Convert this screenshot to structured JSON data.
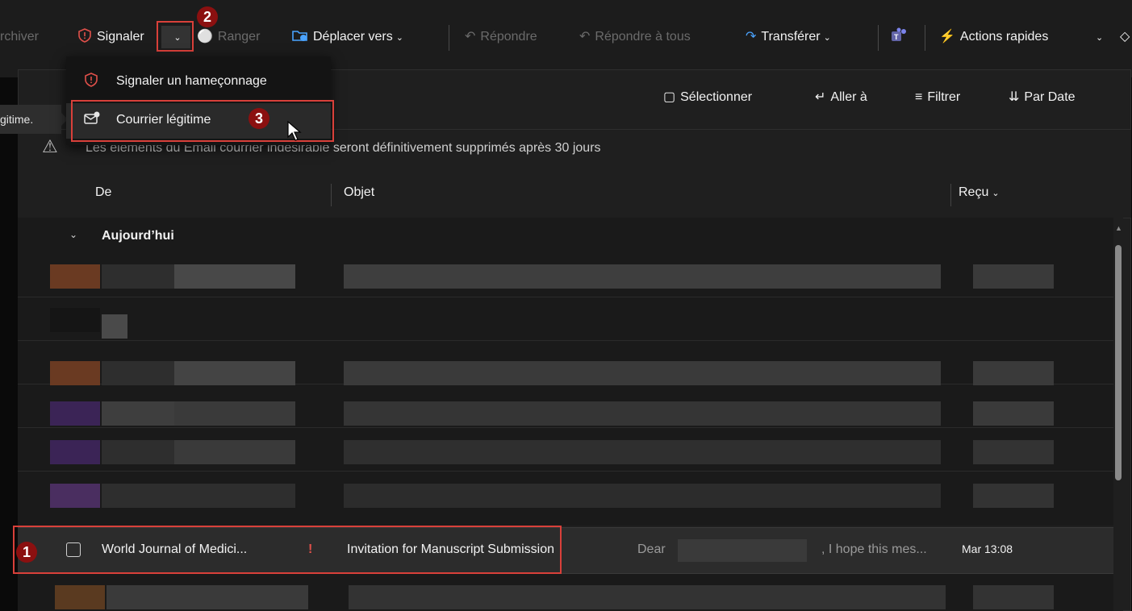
{
  "toolbar": {
    "archive_label": "rchiver",
    "report_label": "Signaler",
    "sweep_label": "Ranger",
    "move_label": "Déplacer vers",
    "reply_label": "Répondre",
    "reply_all_label": "Répondre à tous",
    "forward_label": "Transférer",
    "quick_actions_label": "Actions rapides"
  },
  "report_menu": {
    "items": [
      {
        "label": "Signaler un hameçonnage",
        "icon": "shield-alert-icon"
      },
      {
        "label": "Courrier légitime",
        "icon": "mail-check-icon"
      }
    ]
  },
  "tooltip": {
    "text": "gitime."
  },
  "list_toolbar": {
    "select_label": "Sélectionner",
    "goto_label": "Aller à",
    "filter_label": "Filtrer",
    "sort_label": "Par Date"
  },
  "info_bar": {
    "text": "Les éléments du Email courrier indésirable seront définitivement supprimés après 30 jours"
  },
  "columns": {
    "from": "De",
    "subject": "Objet",
    "received": "Reçu"
  },
  "group": {
    "label": "Aujourd’hui"
  },
  "message": {
    "from": "World Journal of Medici...",
    "importance": "!",
    "subject": "Invitation for Manuscript Submission",
    "preview_start": "Dear",
    "preview_end": ", I hope this mes...",
    "received": "Mar 13:08"
  },
  "annotations": {
    "badge1": "1",
    "badge2": "2",
    "badge3": "3"
  },
  "colors": {
    "accent_red": "#d9403a",
    "badge": "#8b1010",
    "icon_blue": "#4aa3ff",
    "icon_yellow": "#f4b400",
    "teams_purple": "#6264a7"
  }
}
